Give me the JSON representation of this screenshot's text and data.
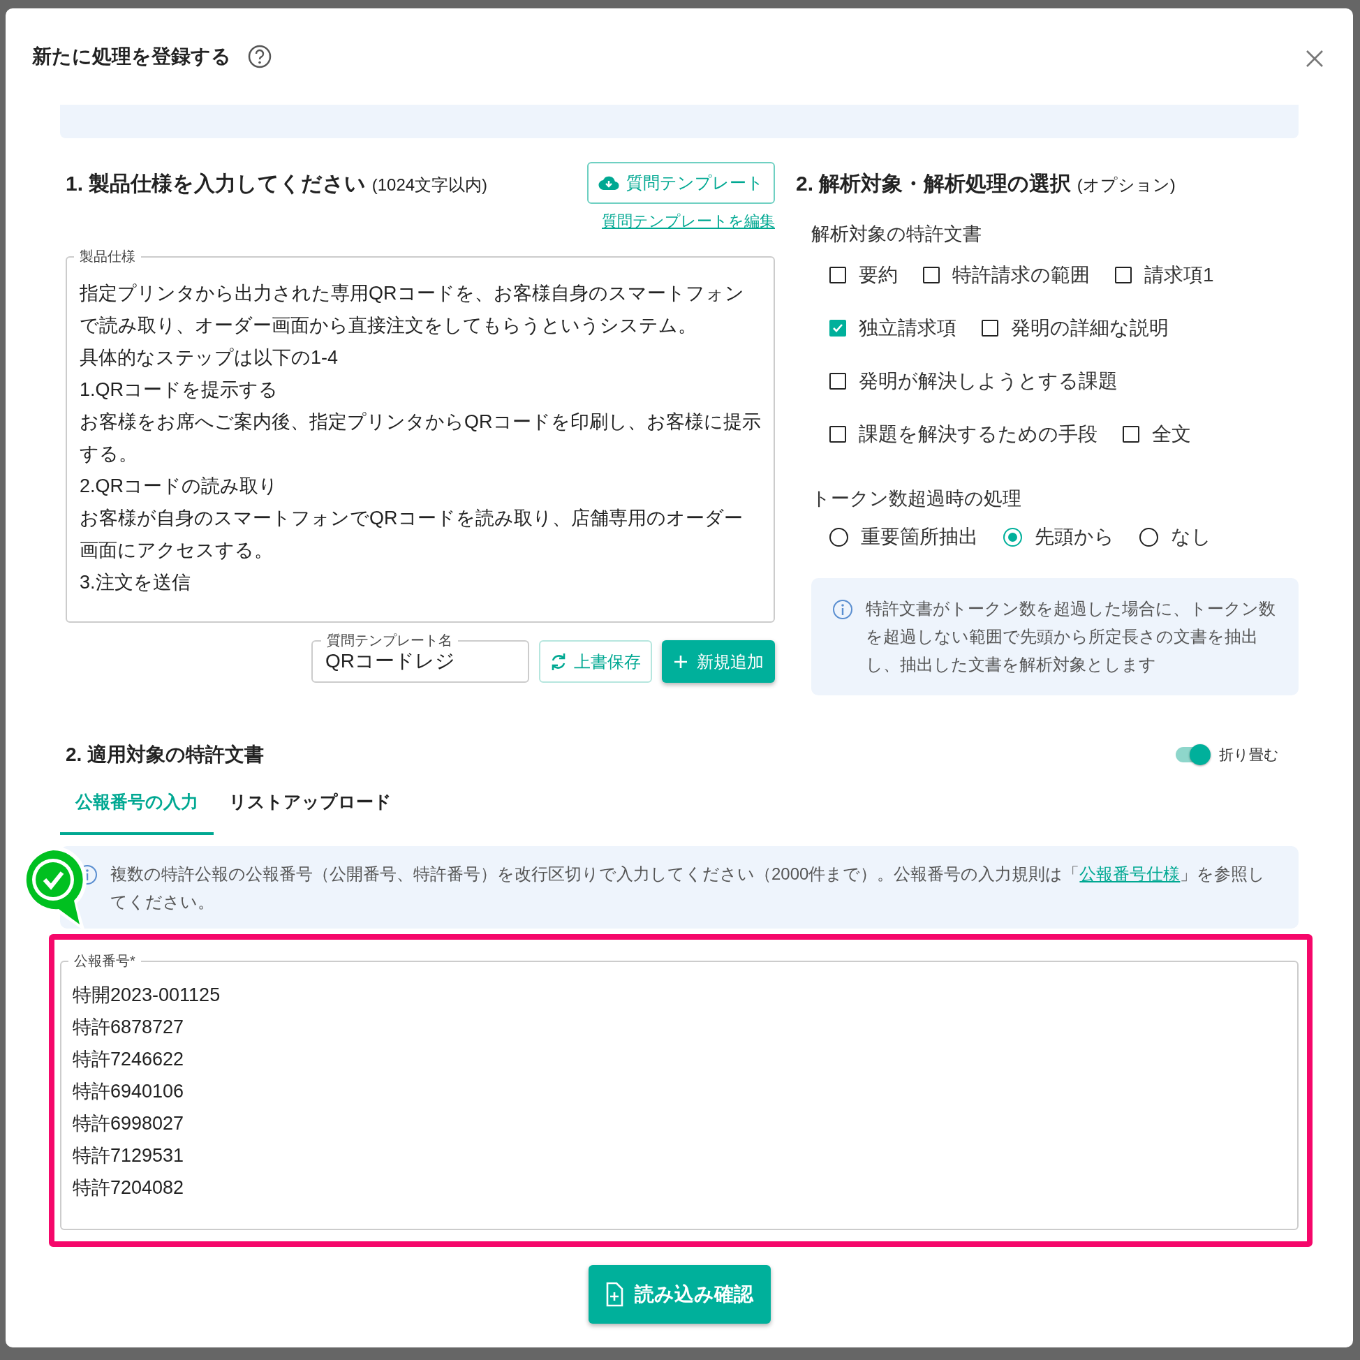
{
  "dialog": {
    "title": "新たに処理を登録する"
  },
  "spec": {
    "heading": "1. 製品仕様を入力してください",
    "note": "(1024文字以内)",
    "template_button": "質問テンプレート",
    "edit_link": "質問テンプレートを編集",
    "field_label": "製品仕様",
    "lines": [
      "指定プリンタから出力された専用QRコードを、お客様自身のスマートフォンで読み取り、オーダー画面から直接注文をしてもらうというシステム。",
      "具体的なステップは以下の1-4",
      "1.QRコードを提示する",
      "お客様をお席へご案内後、指定プリンタからQRコードを印刷し、お客様に提示する。",
      "2.QRコードの読み取り",
      "お客様が自身のスマートフォンでQRコードを読み取り、店舗専用のオーダー画面にアクセスする。",
      "3.注文を送信"
    ],
    "template_name": {
      "label": "質問テンプレート名",
      "value": "QRコードレジ"
    },
    "overwrite_button": "上書保存",
    "add_button": "新規追加"
  },
  "analysis": {
    "heading": "2. 解析対象・解析処理の選択",
    "note": "(オプション)",
    "documents_label": "解析対象の特許文書",
    "document_rows": [
      {
        "items": [
          {
            "label": "要約",
            "checked": false
          },
          {
            "label": "特許請求の範囲",
            "checked": false
          },
          {
            "label": "請求項1",
            "checked": false
          }
        ]
      },
      {
        "items": [
          {
            "label": "独立請求項",
            "checked": true
          },
          {
            "label": "発明の詳細な説明",
            "checked": false
          }
        ]
      },
      {
        "items": [
          {
            "label": "発明が解決しようとする課題",
            "checked": false
          }
        ]
      },
      {
        "items": [
          {
            "label": "課題を解決するための手段",
            "checked": false
          },
          {
            "label": "全文",
            "checked": false
          }
        ]
      }
    ],
    "overflow_label": "トークン数超過時の処理",
    "options": [
      {
        "label": "重要箇所抽出",
        "selected": false
      },
      {
        "label": "先頭から",
        "selected": true
      },
      {
        "label": "なし",
        "selected": false
      }
    ],
    "info": "特許文書がトークン数を超過した場合に、トークン数を超過しない範囲で先頭から所定長さの文書を抽出し、抽出した文書を解析対象とします"
  },
  "target": {
    "heading": "2. 適用対象の特許文書",
    "collapse_toggle": {
      "label": "折り畳む",
      "on": true
    },
    "tabs": [
      {
        "label": "公報番号の入力",
        "selected": true
      },
      {
        "label": "リストアップロード",
        "selected": false
      }
    ],
    "info": {
      "before": "複数の特許公報の公報番号（公開番号、特許番号）を改行区切りで入力してください（2000件まで）。公報番号の入力規則は「",
      "link": "公報番号仕様",
      "after": "」を参照してください。"
    },
    "numbers_field": {
      "label": "公報番号*",
      "lines": [
        "特開2023-001125",
        "特許6878727",
        "特許7246622",
        "特許6940106",
        "特許6998027",
        "特許7129531",
        "特許7204082"
      ]
    },
    "confirm_button": "読み込み確認"
  }
}
